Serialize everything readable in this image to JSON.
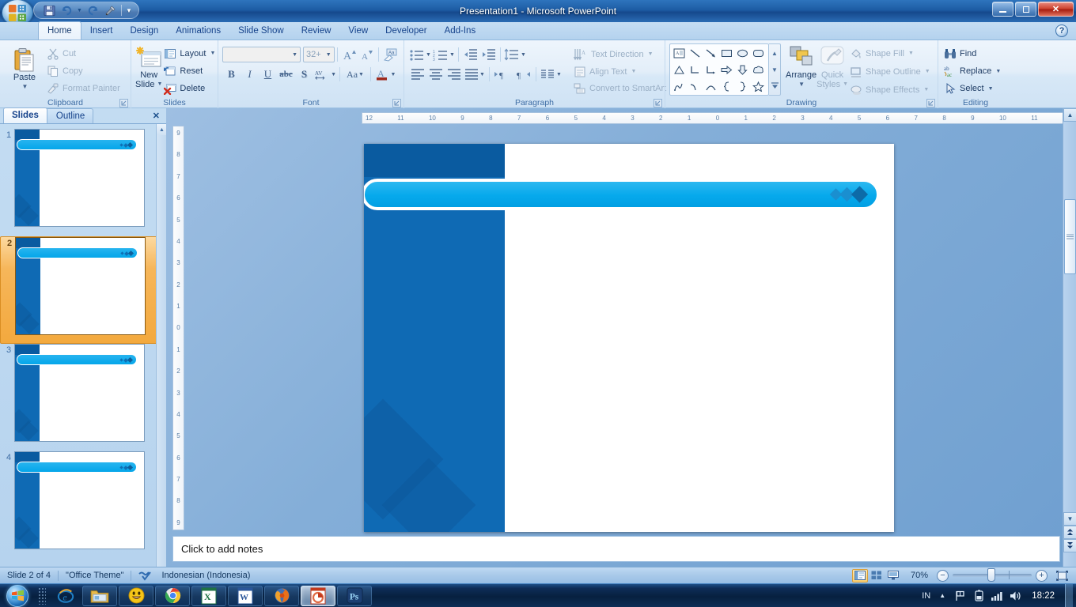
{
  "window": {
    "title": "Presentation1 - Microsoft PowerPoint",
    "minimize": "–",
    "maximize": "❐",
    "close": "✕",
    "office_button": "office-logo",
    "help": "?"
  },
  "quick_access": [
    {
      "name": "save",
      "icon": "save-icon"
    },
    {
      "name": "undo",
      "icon": "undo-icon"
    },
    {
      "name": "undo-dropdown",
      "icon": "chevron-down-icon"
    },
    {
      "name": "redo",
      "icon": "redo-icon"
    },
    {
      "name": "customize-tools",
      "icon": "tools-icon"
    },
    {
      "name": "customize-qat",
      "icon": "chevron-down-icon"
    }
  ],
  "tabs": [
    {
      "label": "Home",
      "active": true
    },
    {
      "label": "Insert",
      "active": false
    },
    {
      "label": "Design",
      "active": false
    },
    {
      "label": "Animations",
      "active": false
    },
    {
      "label": "Slide Show",
      "active": false
    },
    {
      "label": "Review",
      "active": false
    },
    {
      "label": "View",
      "active": false
    },
    {
      "label": "Developer",
      "active": false
    },
    {
      "label": "Add-Ins",
      "active": false
    }
  ],
  "ribbon": {
    "clipboard": {
      "label": "Clipboard",
      "paste": "Paste",
      "cut": "Cut",
      "copy": "Copy",
      "format_painter": "Format Painter"
    },
    "slides": {
      "label": "Slides",
      "new_slide_line1": "New",
      "new_slide_line2": "Slide",
      "layout": "Layout",
      "reset": "Reset",
      "delete": "Delete"
    },
    "font": {
      "label": "Font",
      "font_name_value": "",
      "font_size_value": "32+",
      "bold": "B",
      "italic": "I",
      "underline": "U",
      "strikethrough": "abc",
      "shadow": "S",
      "character_spacing": "AV",
      "change_case": "Aa",
      "font_color": "A",
      "grow_font": "A",
      "shrink_font": "A",
      "clear_formatting": "Aa"
    },
    "paragraph": {
      "label": "Paragraph",
      "text_direction": "Text Direction",
      "align_text": "Align Text",
      "convert_to_smartart": "Convert to SmartArt"
    },
    "drawing": {
      "label": "Drawing",
      "arrange": "Arrange",
      "quick_styles_line1": "Quick",
      "quick_styles_line2": "Styles",
      "shape_fill": "Shape Fill",
      "shape_outline": "Shape Outline",
      "shape_effects": "Shape Effects",
      "shapes": [
        "text-box-shape",
        "line-shape",
        "arrow-shape",
        "rectangle-shape",
        "oval-shape",
        "rounded-rectangle-shape",
        "triangle-shape",
        "elbow-connector-shape",
        "elbow-arrow-connector-shape",
        "right-arrow-shape",
        "down-arrow-shape",
        "cloud-shape",
        "scribble-shape",
        "curve-shape",
        "arc-shape",
        "left-brace-shape",
        "right-brace-shape",
        "star-shape"
      ]
    },
    "editing": {
      "label": "Editing",
      "find": "Find",
      "replace": "Replace",
      "select": "Select"
    }
  },
  "left_panel": {
    "tabs": [
      {
        "label": "Slides",
        "active": true
      },
      {
        "label": "Outline",
        "active": false
      }
    ],
    "close": "✕",
    "slides": [
      {
        "number": "1",
        "selected": false
      },
      {
        "number": "2",
        "selected": true
      },
      {
        "number": "3",
        "selected": false
      },
      {
        "number": "4",
        "selected": false
      }
    ]
  },
  "ruler": {
    "horizontal": [
      "12",
      "11",
      "10",
      "9",
      "8",
      "7",
      "6",
      "5",
      "4",
      "3",
      "2",
      "1",
      "0",
      "1",
      "2",
      "3",
      "4",
      "5",
      "6",
      "7",
      "8",
      "9",
      "10",
      "11",
      "12"
    ],
    "vertical": [
      "9",
      "8",
      "7",
      "6",
      "5",
      "4",
      "3",
      "2",
      "1",
      "0",
      "1",
      "2",
      "3",
      "4",
      "5",
      "6",
      "7",
      "8",
      "9"
    ]
  },
  "slide": {
    "theme_colors": {
      "left_bar": "#0f6ab4",
      "top_header": "#0a5ba0",
      "banner_start": "#2cb8f0",
      "banner_end": "#029fe3",
      "diamond": "rgba(12,86,150,.40)"
    },
    "dots_count": 3
  },
  "notes": {
    "placeholder": "Click to add notes"
  },
  "status_bar": {
    "slide_info": "Slide 2 of 4",
    "theme": "\"Office Theme\"",
    "language": "Indonesian (Indonesia)",
    "spell_icon": "spell-check-icon",
    "zoom_value": "70%",
    "zoom_out": "−",
    "zoom_in": "+",
    "views": [
      {
        "name": "normal-view",
        "active": true
      },
      {
        "name": "slide-sorter-view",
        "active": false
      },
      {
        "name": "slide-show-view",
        "active": false
      }
    ],
    "fit_to_window": "fit-slide-icon"
  },
  "taskbar": {
    "start": "windows-start-icon",
    "items": [
      {
        "name": "internet-explorer",
        "icon": "ie-icon",
        "active": false,
        "plain": true
      },
      {
        "name": "windows-explorer",
        "icon": "folder-icon",
        "active": false
      },
      {
        "name": "yahoo-messenger",
        "icon": "smiley-icon",
        "active": false
      },
      {
        "name": "google-chrome",
        "icon": "chrome-icon",
        "active": false
      },
      {
        "name": "microsoft-excel",
        "icon": "excel-icon",
        "active": false
      },
      {
        "name": "microsoft-word",
        "icon": "word-icon",
        "active": false
      },
      {
        "name": "mozilla-firefox",
        "icon": "firefox-icon",
        "active": false
      },
      {
        "name": "microsoft-powerpoint",
        "icon": "powerpoint-icon",
        "active": true
      },
      {
        "name": "adobe-photoshop",
        "icon": "photoshop-icon",
        "active": false
      }
    ],
    "tray": {
      "language": "IN",
      "show_hidden": "chevron-up-icon",
      "action_center": "flag-icon",
      "battery": "battery-icon",
      "network": "signal-icon",
      "volume": "speaker-icon",
      "clock": "18:22"
    }
  }
}
